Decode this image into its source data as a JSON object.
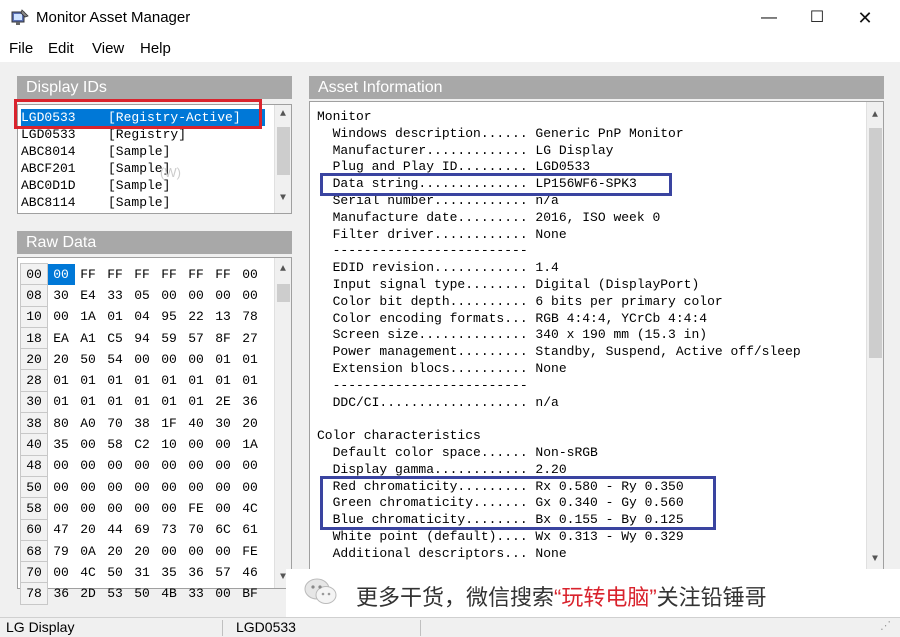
{
  "window": {
    "title": "Monitor Asset Manager",
    "minimize": "—",
    "maximize": "☐",
    "close": "✕"
  },
  "menu": [
    "File",
    "Edit",
    "View",
    "Help"
  ],
  "display_ids": {
    "title": "Display IDs",
    "items": [
      {
        "id": "LGD0533",
        "tag": "[Registry-Active]",
        "selected": true
      },
      {
        "id": "LGD0533",
        "tag": "[Registry]"
      },
      {
        "id": "ABC8014",
        "tag": "[Sample]"
      },
      {
        "id": "ABCF201",
        "tag": "[Sample]"
      },
      {
        "id": "ABC0D1D",
        "tag": "[Sample]"
      },
      {
        "id": "ABC8114",
        "tag": "[Sample]"
      }
    ],
    "ghost": "(W)"
  },
  "raw_data": {
    "title": "Raw Data",
    "rows": [
      [
        "00",
        "00",
        "FF",
        "FF",
        "FF",
        "FF",
        "FF",
        "FF",
        "00"
      ],
      [
        "08",
        "30",
        "E4",
        "33",
        "05",
        "00",
        "00",
        "00",
        "00"
      ],
      [
        "10",
        "00",
        "1A",
        "01",
        "04",
        "95",
        "22",
        "13",
        "78"
      ],
      [
        "18",
        "EA",
        "A1",
        "C5",
        "94",
        "59",
        "57",
        "8F",
        "27"
      ],
      [
        "20",
        "20",
        "50",
        "54",
        "00",
        "00",
        "00",
        "01",
        "01"
      ],
      [
        "28",
        "01",
        "01",
        "01",
        "01",
        "01",
        "01",
        "01",
        "01"
      ],
      [
        "30",
        "01",
        "01",
        "01",
        "01",
        "01",
        "01",
        "2E",
        "36"
      ],
      [
        "38",
        "80",
        "A0",
        "70",
        "38",
        "1F",
        "40",
        "30",
        "20"
      ],
      [
        "40",
        "35",
        "00",
        "58",
        "C2",
        "10",
        "00",
        "00",
        "1A"
      ],
      [
        "48",
        "00",
        "00",
        "00",
        "00",
        "00",
        "00",
        "00",
        "00"
      ],
      [
        "50",
        "00",
        "00",
        "00",
        "00",
        "00",
        "00",
        "00",
        "00"
      ],
      [
        "58",
        "00",
        "00",
        "00",
        "00",
        "00",
        "FE",
        "00",
        "4C"
      ],
      [
        "60",
        "47",
        "20",
        "44",
        "69",
        "73",
        "70",
        "6C",
        "61"
      ],
      [
        "68",
        "79",
        "0A",
        "20",
        "20",
        "00",
        "00",
        "00",
        "FE"
      ],
      [
        "70",
        "00",
        "4C",
        "50",
        "31",
        "35",
        "36",
        "57",
        "46"
      ],
      [
        "78",
        "36",
        "2D",
        "53",
        "50",
        "4B",
        "33",
        "00",
        "BF"
      ]
    ]
  },
  "asset_info": {
    "title": "Asset Information",
    "lines": [
      "Monitor",
      "  Windows description...... Generic PnP Monitor",
      "  Manufacturer............. LG Display",
      "  Plug and Play ID......... LGD0533",
      "  Data string.............. LP156WF6-SPK3",
      "  Serial number............ n/a",
      "  Manufacture date......... 2016, ISO week 0",
      "  Filter driver............ None",
      "  -------------------------",
      "  EDID revision............ 1.4",
      "  Input signal type........ Digital (DisplayPort)",
      "  Color bit depth.......... 6 bits per primary color",
      "  Color encoding formats... RGB 4:4:4, YCrCb 4:4:4",
      "  Screen size.............. 340 x 190 mm (15.3 in)",
      "  Power management......... Standby, Suspend, Active off/sleep",
      "  Extension blocs.......... None",
      "  -------------------------",
      "  DDC/CI................... n/a",
      "",
      "Color characteristics",
      "  Default color space...... Non-sRGB",
      "  Display gamma............ 2.20",
      "  Red chromaticity......... Rx 0.580 - Ry 0.350",
      "  Green chromaticity....... Gx 0.340 - Gy 0.560",
      "  Blue chromaticity........ Bx 0.155 - By 0.125",
      "  White point (default).... Wx 0.313 - Wy 0.329",
      "  Additional descriptors... None"
    ]
  },
  "watermark": {
    "pre": "更多干货，微信搜索",
    "highlight": "“玩转电脑”",
    "post": "关注铅锤哥"
  },
  "status": {
    "left": "LG Display",
    "right": "LGD0533"
  },
  "colors": {
    "selection": "#0078d7",
    "red_box": "#d9232d",
    "blue_box": "#3a44a0",
    "group_header": "#a8a8a8"
  }
}
